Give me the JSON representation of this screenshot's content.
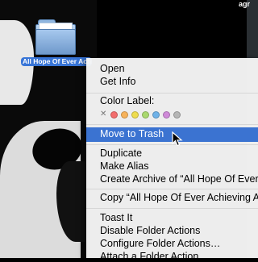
{
  "menubar": {
    "fragment": "agr"
  },
  "desktop": {
    "folder_name": "All Hope Of Ever Achieving Anything"
  },
  "context_menu": {
    "items": [
      {
        "label": "Open"
      },
      {
        "label": "Get Info"
      }
    ],
    "color_label_heading": "Color Label:",
    "color_labels": [
      {
        "name": "none",
        "color": "#888888"
      },
      {
        "name": "red",
        "color": "#f26d6d"
      },
      {
        "name": "orange",
        "color": "#f6b25a"
      },
      {
        "name": "yellow",
        "color": "#eedc4e"
      },
      {
        "name": "green",
        "color": "#a9d86e"
      },
      {
        "name": "blue",
        "color": "#6fb2e8"
      },
      {
        "name": "purple",
        "color": "#cf8ad8"
      },
      {
        "name": "gray",
        "color": "#b5b5b5"
      }
    ],
    "highlighted": "Move to Trash",
    "items2": [
      {
        "label": "Duplicate"
      },
      {
        "label": "Make Alias"
      },
      {
        "label": "Create Archive of “All Hope Of Ever A"
      }
    ],
    "copy_item": "Copy “All Hope Of Ever Achieving An",
    "items3": [
      {
        "label": "Toast It"
      },
      {
        "label": "Disable Folder Actions"
      },
      {
        "label": "Configure Folder Actions…"
      },
      {
        "label": "Attach a Folder Action"
      }
    ]
  }
}
